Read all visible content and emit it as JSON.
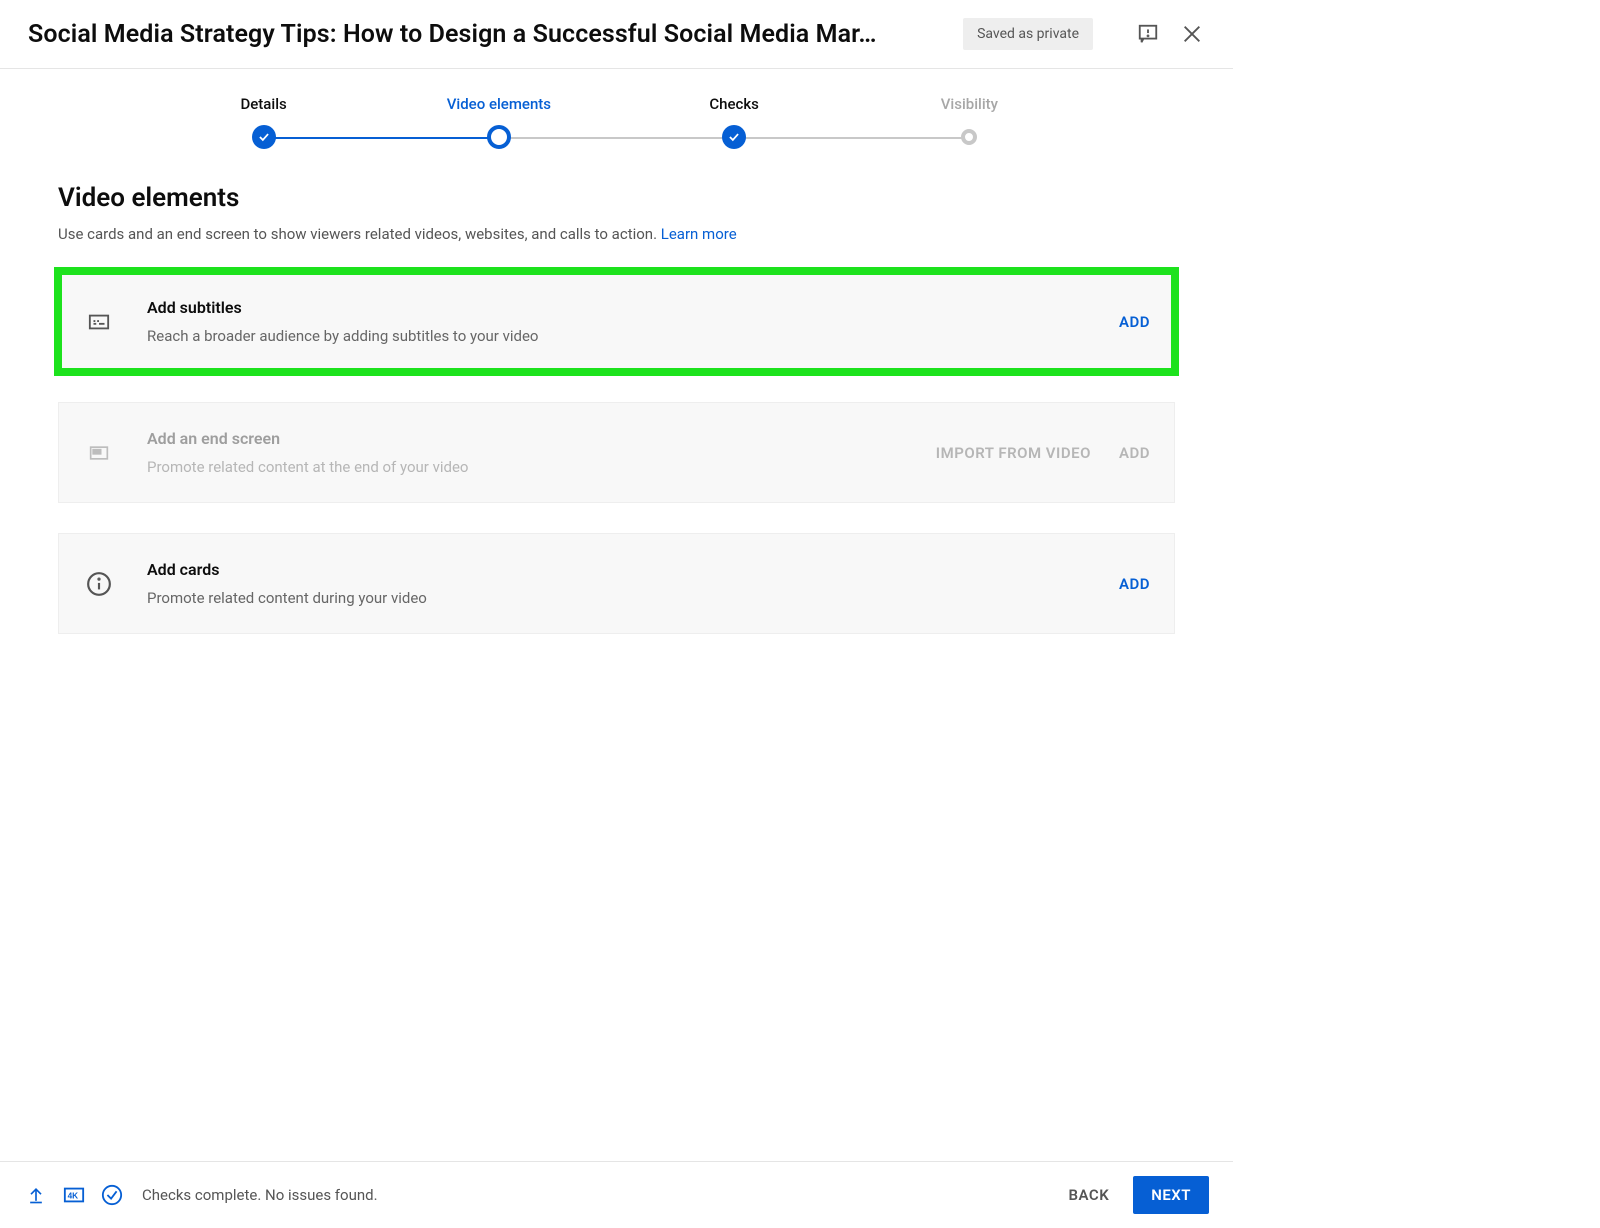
{
  "header": {
    "title": "Social Media Strategy Tips: How to Design a Successful Social Media Mar…",
    "save_badge": "Saved as private"
  },
  "steps": [
    {
      "label": "Details"
    },
    {
      "label": "Video elements"
    },
    {
      "label": "Checks"
    },
    {
      "label": "Visibility"
    }
  ],
  "section": {
    "title": "Video elements",
    "subtitle": "Use cards and an end screen to show viewers related videos, websites, and calls to action. ",
    "learn_more": "Learn more"
  },
  "rows": {
    "subtitles": {
      "title": "Add subtitles",
      "desc": "Reach a broader audience by adding subtitles to your video",
      "action": "ADD"
    },
    "endscreen": {
      "title": "Add an end screen",
      "desc": "Promote related content at the end of your video",
      "action_import": "IMPORT FROM VIDEO",
      "action_add": "ADD"
    },
    "cards": {
      "title": "Add cards",
      "desc": "Promote related content during your video",
      "action": "ADD"
    }
  },
  "footer": {
    "status": "Checks complete. No issues found.",
    "back": "BACK",
    "next": "NEXT"
  }
}
